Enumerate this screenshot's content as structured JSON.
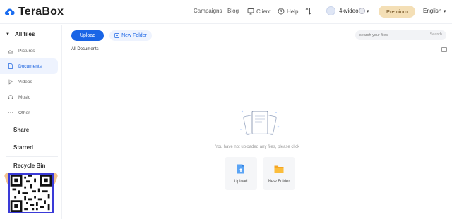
{
  "app": {
    "name": "TeraBox"
  },
  "topnav": {
    "campaigns": "Campaigns",
    "blog": "Blog",
    "client": "Client",
    "help": "Help",
    "username": "4kvideo",
    "premium": "Premium",
    "language": "English"
  },
  "sidebar": {
    "all_files": "All files",
    "items": [
      {
        "label": "Pictures",
        "icon": "picture-icon"
      },
      {
        "label": "Documents",
        "icon": "document-icon",
        "active": true
      },
      {
        "label": "Videos",
        "icon": "video-icon"
      },
      {
        "label": "Music",
        "icon": "music-icon"
      },
      {
        "label": "Other",
        "icon": "other-icon"
      }
    ],
    "share": "Share",
    "starred": "Starred",
    "recycle_bin": "Recycle Bin"
  },
  "toolbar": {
    "upload": "Upload",
    "new_folder": "New Folder",
    "search_placeholder": "search your files",
    "search_button": "Search"
  },
  "breadcrumb": "All Documents",
  "empty": {
    "message": "You have not uploaded any files, please click",
    "upload_tile": "Upload",
    "folder_tile": "New Folder"
  },
  "colors": {
    "accent": "#1a65e6",
    "premium_bg": "#f4dfb6",
    "active_bg": "#eef3fe"
  }
}
